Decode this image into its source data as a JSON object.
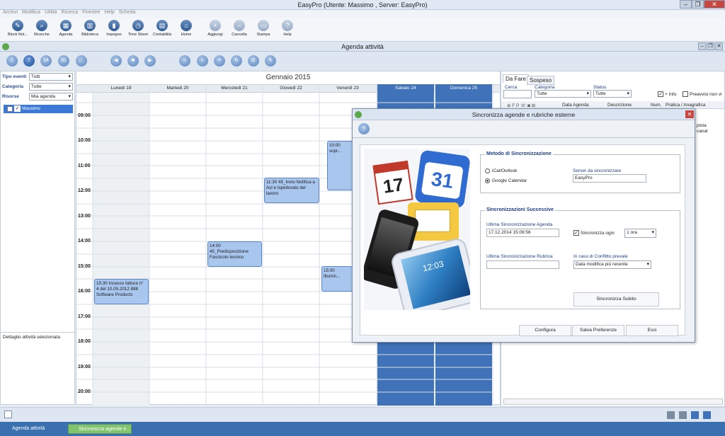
{
  "window": {
    "title": "EasyPro (Utente: Massimo , Server: EasyPro)",
    "min": "–",
    "max": "❐",
    "close": "✕"
  },
  "menu": [
    "Archivi",
    "Modifica",
    "Utilità",
    "Ricerca",
    "Finestre",
    "Help",
    "Scheda"
  ],
  "ribbon": [
    {
      "label": "Block Not...",
      "icon": "notepad-icon"
    },
    {
      "label": "Ricerche",
      "icon": "search-icon"
    },
    {
      "label": "Agenda",
      "icon": "calendar-icon"
    },
    {
      "label": "Biblioteca",
      "icon": "library-icon"
    },
    {
      "label": "Impegno",
      "icon": "chart-icon"
    },
    {
      "label": "Time Sheet",
      "icon": "clock-icon"
    },
    {
      "label": "Contabilità",
      "icon": "calculator-icon"
    },
    {
      "label": "Home",
      "icon": "home-icon"
    },
    {
      "label": "Aggiungi",
      "icon": "add-icon"
    },
    {
      "label": "Cancella",
      "icon": "delete-icon"
    },
    {
      "label": "Stampa",
      "icon": "print-icon"
    },
    {
      "label": "Help",
      "icon": "help-icon"
    }
  ],
  "doc": {
    "title": "Agenda attività"
  },
  "toolbar": {
    "views": [
      "1",
      "7",
      "14",
      "31",
      "…"
    ]
  },
  "filters": {
    "tipo_label": "Tipo eventi",
    "tipo_value": "Tutti",
    "categoria_label": "Categoria",
    "categoria_value": "Tutte",
    "risorse_label": "Risorse",
    "risorse_value": "Mia agenda",
    "resource": "Massimo",
    "detail_title": "Dettaglio attività selezionata"
  },
  "calendar": {
    "month": "Gennaio 2015",
    "days": [
      "Lunedì 19",
      "Martedì 20",
      "Mercoledì 21",
      "Giovedì 22",
      "Venerdì 23",
      "Sabato 24",
      "Domenica 25"
    ],
    "hours": [
      "09:00",
      "10:00",
      "11:00",
      "12:00",
      "13:00",
      "14:00",
      "15:00",
      "16:00",
      "17:00",
      "18:00",
      "19:00",
      "20:00"
    ],
    "appointments": [
      {
        "text": "10:00 sopr..."
      },
      {
        "text": "11:30 45_Invio Notifica a Asl e Ispettorato del lavoro"
      },
      {
        "text": "14:00 45_Predisposizione Fascicolo tecnico"
      },
      {
        "text": "15:00 Illumin..."
      },
      {
        "text": "15:30 Incasso fattura n° 4 del 10.05.2012 888 Software Products"
      }
    ]
  },
  "right": {
    "tabs": [
      "Da Fare",
      "Sospeso"
    ],
    "cerca_label": "Cerca",
    "categoria_label": "Categoria",
    "categoria_value": "Tutte",
    "status_label": "Status",
    "status_value": "Tutte",
    "info_label": "+ Info",
    "preavvisi_label": "Preavvisi non vi",
    "columns": [
      "Data Agenda",
      "Descrizione",
      "Num.",
      "Pratica / Anagrafica"
    ],
    "side1": "pista",
    "side2": "canal"
  },
  "dialog": {
    "title": "Sincronizza agende e rubriche esterne",
    "help": "?",
    "metodo_title": "Metodo di Sincronizzazione",
    "ical": "iCal/Outlook",
    "google": "Google Calendar",
    "server_label": "Server da sincronizzare",
    "server_value": "EasyPro",
    "succ_title": "Sincronizzazioni Successive",
    "ult_agenda_label": "Ultima Sincronizzazione Agenda",
    "ult_agenda_value": "17.12.2014 15:09:56",
    "sinc_ogni_label": "Sincronizza ogni",
    "sinc_ogni_value": "1 ora",
    "ult_rubrica_label": "Ultima Sincronizzazione Rubrica",
    "conflitto_label": "In caso di Conflitto prevale",
    "conflitto_value": "Data modifica più recente",
    "sinc_subito": "Sincronizza Subito",
    "configura": "Configura",
    "salva": "Salva Preferenze",
    "esci": "Esci",
    "image_calendar_day": "31",
    "image_phone_time": "12:03"
  },
  "taskbar": [
    "Agenda attività",
    "Sincronizza agende e..."
  ]
}
